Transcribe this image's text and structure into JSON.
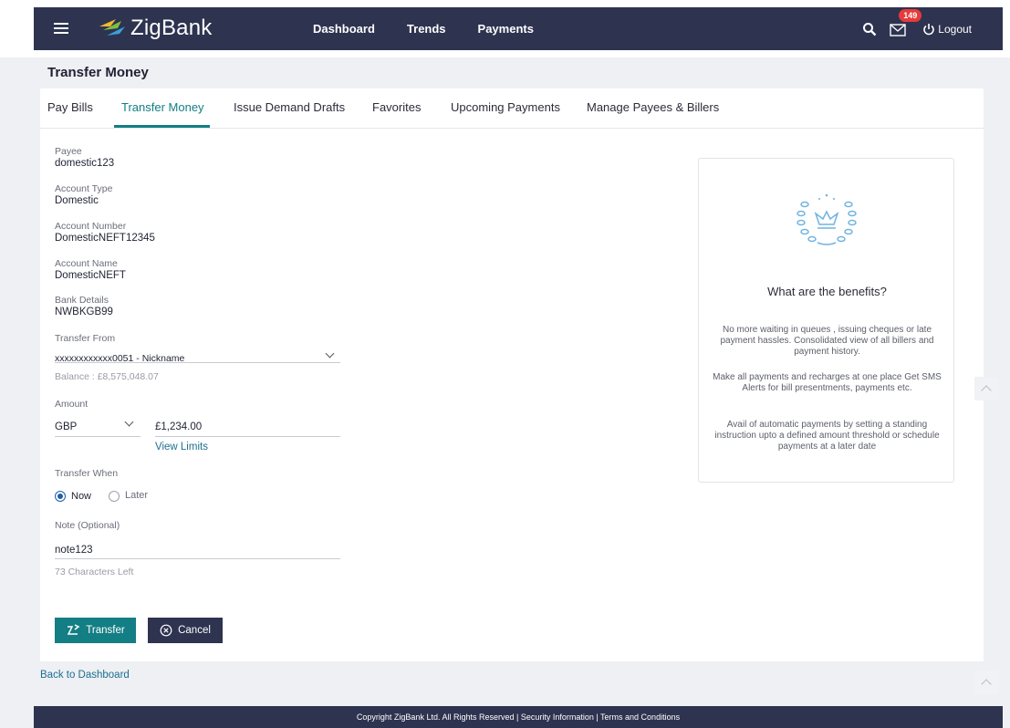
{
  "brand": {
    "name": "ZigBank"
  },
  "nav": {
    "links": [
      "Dashboard",
      "Trends",
      "Payments"
    ],
    "notification_count": "149",
    "logout_label": "Logout"
  },
  "page": {
    "title": "Transfer Money"
  },
  "tabs": [
    {
      "label": "Pay Bills",
      "active": false
    },
    {
      "label": "Transfer Money",
      "active": true
    },
    {
      "label": "Issue Demand Drafts",
      "active": false
    },
    {
      "label": "Favorites",
      "active": false
    },
    {
      "label": "Upcoming Payments",
      "active": false
    },
    {
      "label": "Manage Payees & Billers",
      "active": false
    }
  ],
  "details": [
    {
      "label": "Payee",
      "value": "domestic123"
    },
    {
      "label": "Account Type",
      "value": "Domestic"
    },
    {
      "label": "Account Number",
      "value": "DomesticNEFT12345"
    },
    {
      "label": "Account Name",
      "value": "DomesticNEFT"
    },
    {
      "label": "Bank Details",
      "value": "NWBKGB99"
    }
  ],
  "transfer_from": {
    "label": "Transfer From",
    "value": "xxxxxxxxxxxx0051 - Nickname",
    "balance": "Balance : £8,575,048.07"
  },
  "amount": {
    "label": "Amount",
    "currency": "GBP",
    "value": "£1,234.00",
    "view_limits": "View Limits"
  },
  "transfer_when": {
    "label": "Transfer When",
    "options": [
      "Now",
      "Later"
    ],
    "selected": "Now"
  },
  "note": {
    "label": "Note (Optional)",
    "value": "note123",
    "chars_left": "73 Characters Left"
  },
  "buttons": {
    "transfer": "Transfer",
    "cancel": "Cancel"
  },
  "benefits": {
    "title": "What are the benefits?",
    "paragraphs": [
      "No more waiting in queues , issuing cheques or late payment hassles. Consolidated view of all billers and payment history.",
      "Make all payments and recharges at one place Get SMS Alerts for bill presentments, payments etc.",
      "Avail of automatic payments by setting a standing instruction upto a defined amount threshold or schedule payments at a later date"
    ]
  },
  "back_link": "Back to Dashboard",
  "footer": "Copyright ZigBank Ltd. All Rights Reserved | Security Information | Terms and Conditions",
  "colors": {
    "navbar": "#2e3350",
    "accent": "#137e84",
    "badge": "#e63b3b"
  }
}
